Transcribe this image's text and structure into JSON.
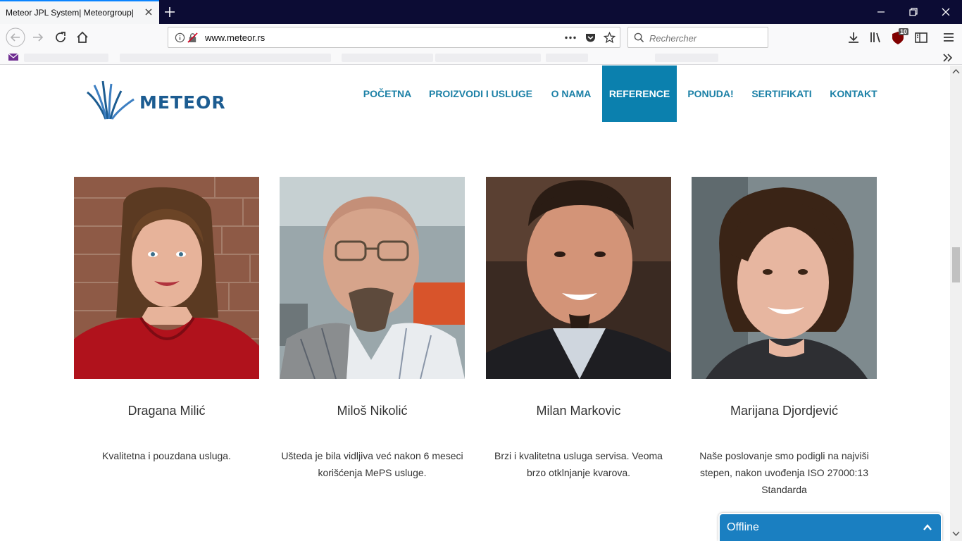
{
  "browser": {
    "tab_title": "Meteor JPL System| Meteorgroup| M",
    "url": "www.meteor.rs",
    "search_placeholder": "Rechercher",
    "library_badge": "10"
  },
  "site": {
    "logo_text": "METEOR",
    "brand_color": "#1c5c91",
    "accent_color": "#0b80ae",
    "nav": [
      {
        "label": "POČETNA",
        "active": false
      },
      {
        "label": "PROIZVODI I USLUGE",
        "active": false
      },
      {
        "label": "O NAMA",
        "active": false
      },
      {
        "label": "REFERENCE",
        "active": true
      },
      {
        "label": "PONUDA!",
        "active": false
      },
      {
        "label": "SERTIFIKATI",
        "active": false
      },
      {
        "label": "KONTAKT",
        "active": false
      }
    ]
  },
  "testimonials": [
    {
      "name": "Dragana Milić",
      "quote": "Kvalitetna i pouzdana usluga.",
      "photo": "woman-red-top-brick-wall"
    },
    {
      "name": "Miloš Nikolić",
      "quote": "Ušteda je bila vidljiva već nakon 6 meseci korišćenja MePS usluge.",
      "photo": "bald-man-glasses-striped-shirt"
    },
    {
      "name": "Milan Markovic",
      "quote": "Brzi i kvalitetna usluga servisa. Veoma brzo otklnjanje kvarova.",
      "photo": "man-goatee-dark-jacket"
    },
    {
      "name": "Marijana Djordjević",
      "quote": "Naše poslovanje smo podigli na najviši stepen, nakon uvođenja ISO 27000:13 Standarda",
      "photo": "young-woman-short-dark-hair"
    }
  ],
  "chat": {
    "label": "Offline"
  }
}
